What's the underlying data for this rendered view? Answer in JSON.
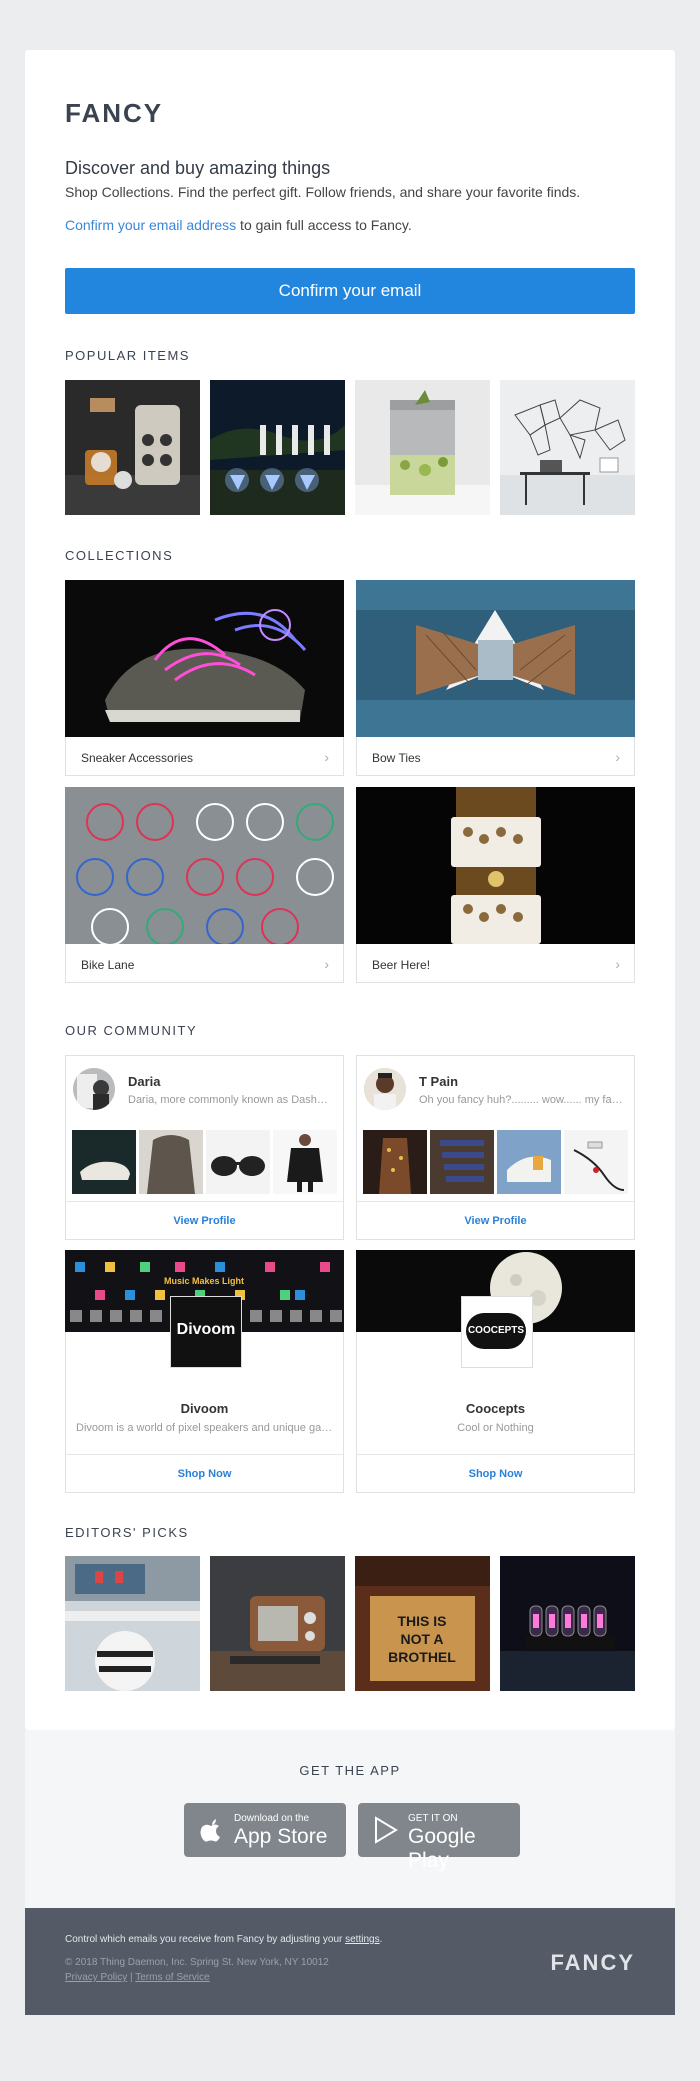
{
  "brand": {
    "logo": "FANCY"
  },
  "intro": {
    "headline": "Discover and buy amazing things",
    "subline": "Shop Collections. Find the perfect gift. Follow friends, and share your favorite finds.",
    "confirm_link": "Confirm your email address",
    "confirm_rest": " to gain full access to Fancy.",
    "cta_label": "Confirm your email"
  },
  "popular": {
    "title": "POPULAR ITEMS",
    "items": [
      "whisky-ice-press",
      "solar-garden-lights",
      "stainless-tumbler",
      "geometric-world-map-decor"
    ]
  },
  "collections": {
    "title": "COLLECTIONS",
    "items": [
      {
        "label": "Sneaker Accessories"
      },
      {
        "label": "Bow Ties"
      },
      {
        "label": "Bike Lane"
      },
      {
        "label": "Beer Here!"
      }
    ]
  },
  "community": {
    "title": "OUR COMMUNITY",
    "users": [
      {
        "name": "Daria",
        "desc": "Daria, more commonly known as Dasha, is a New York based designer",
        "link": "View Profile"
      },
      {
        "name": "T Pain",
        "desc": "Oh you fancy huh?......... wow...... my fancy list",
        "link": "View Profile"
      }
    ],
    "shops": [
      {
        "name": "Divoom",
        "desc": "Divoom is a world of pixel speakers and unique gadgets",
        "link": "Shop Now",
        "logo_text": "Divoom",
        "banner_text": "Music Makes Light"
      },
      {
        "name": "Coocepts",
        "desc": "Cool or Nothing",
        "link": "Shop Now",
        "logo_text": "COOCEPTS"
      }
    ]
  },
  "editors": {
    "title": "EDITORS' PICKS",
    "items": [
      "humidifier",
      "retro-radio-speaker",
      "doormat",
      "nixie-clock"
    ],
    "doormat_text": [
      "THIS IS",
      "NOT A",
      "BROTHEL"
    ]
  },
  "app": {
    "title": "GET THE APP",
    "appstore_small": "Download on the",
    "appstore_big": "App Store",
    "google_small": "GET IT ON",
    "google_big": "Google Play"
  },
  "footer": {
    "line1_pre": "Control which emails you receive from Fancy by adjusting your ",
    "settings_link": "settings",
    "line1_post": ".",
    "copyright": "© 2018 Thing Daemon, Inc. Spring St. New York, NY 10012",
    "privacy": "Privacy Policy",
    "sep": " | ",
    "terms": "Terms of Service",
    "logo": "FANCY"
  },
  "colors": {
    "accent": "#2386de",
    "link": "#2980d9",
    "footer_bg": "#545b66",
    "page_bg": "#ebedef"
  }
}
